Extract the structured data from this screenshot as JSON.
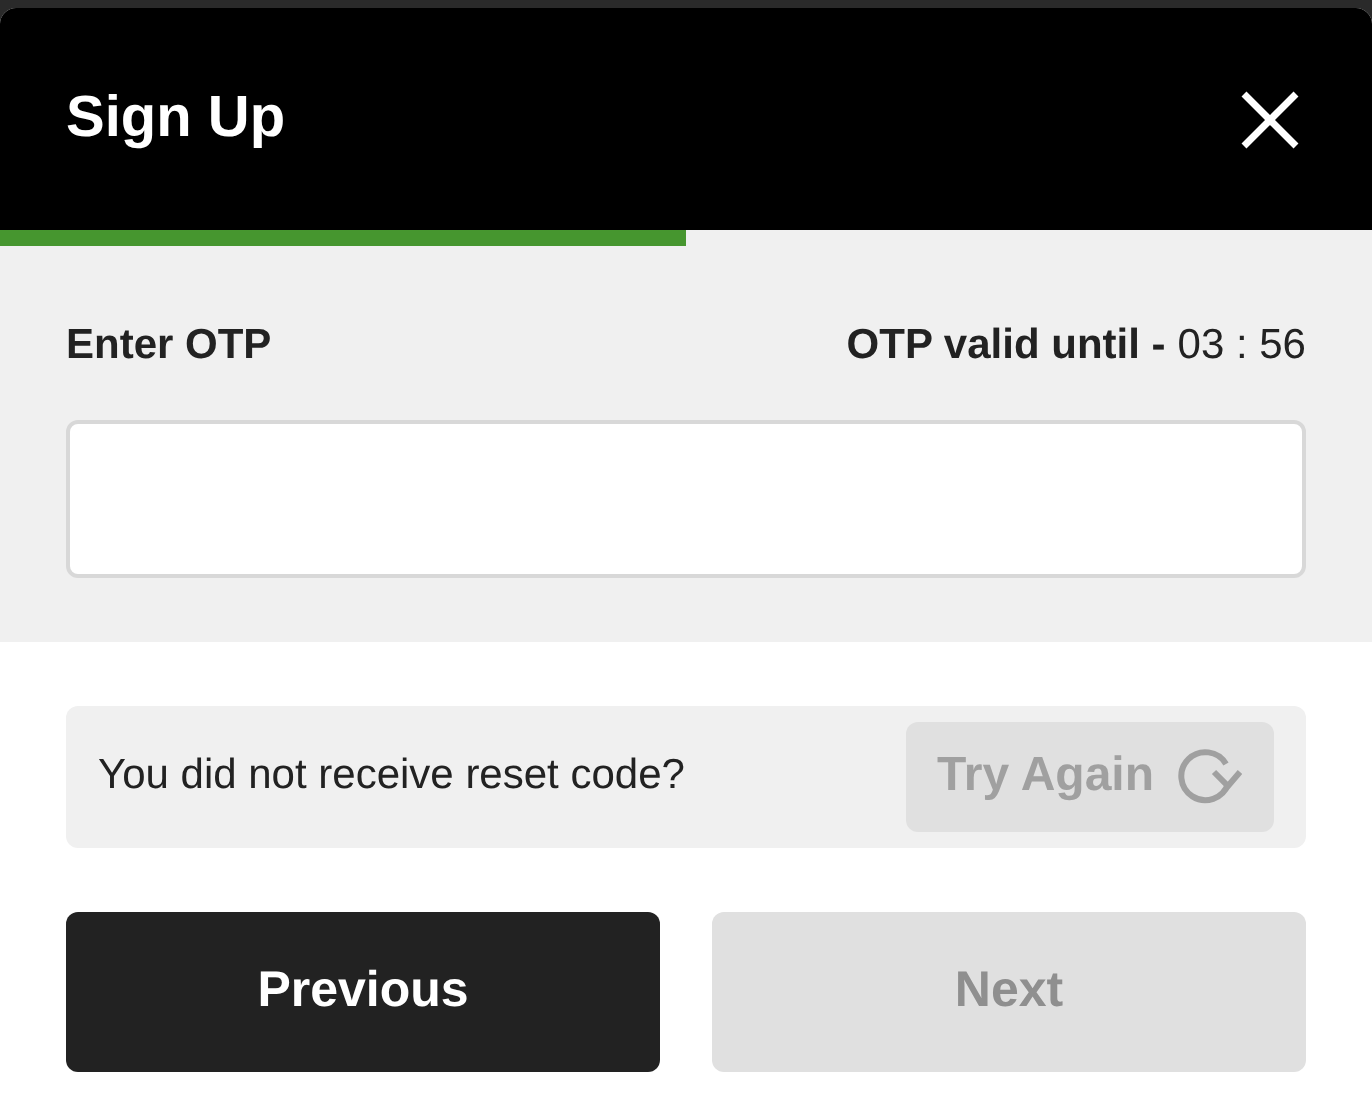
{
  "dialog": {
    "title": "Sign Up",
    "progress": {
      "level": 0.5
    }
  },
  "otp": {
    "label": "Enter OTP",
    "validity_label": "OTP valid until -",
    "timer": "03 : 56"
  },
  "resend": {
    "text": "You did not receive reset code?",
    "button": {
      "label": "Try Again",
      "disabled": true
    }
  },
  "buttons": [
    {
      "label": "Previous",
      "kind": "secondary",
      "disabled": false
    },
    {
      "label": "Next",
      "kind": "primary",
      "disabled": true
    }
  ]
}
